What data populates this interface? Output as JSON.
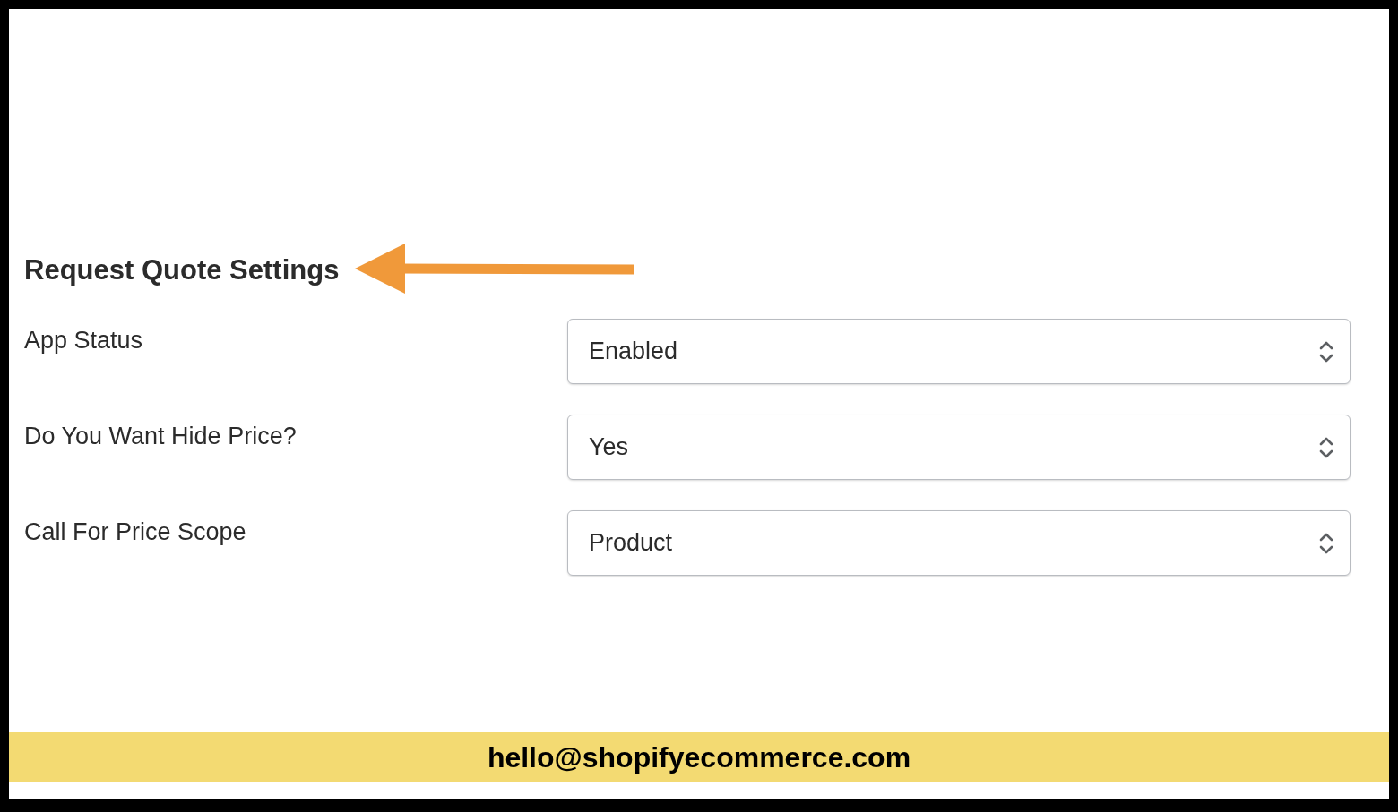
{
  "heading": "Request Quote Settings",
  "settings": [
    {
      "label": "App Status",
      "value": "Enabled"
    },
    {
      "label": "Do You Want Hide Price?",
      "value": "Yes"
    },
    {
      "label": "Call For Price Scope",
      "value": "Product"
    }
  ],
  "banner": "hello@shopifyecommerce.com"
}
